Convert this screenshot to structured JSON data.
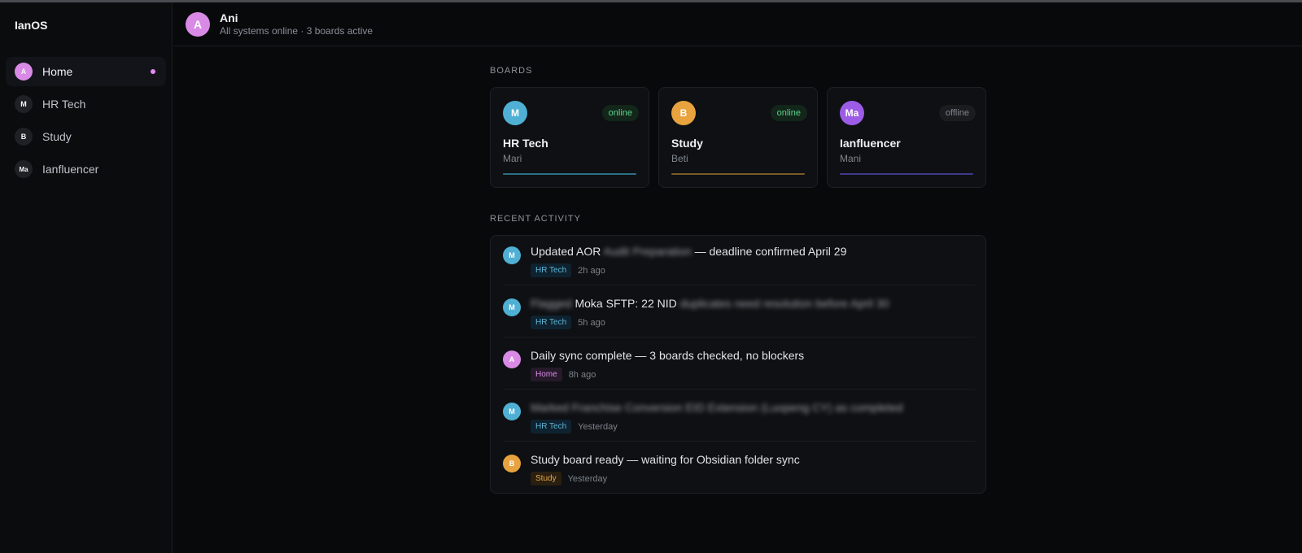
{
  "app": {
    "brand": "IanOS"
  },
  "sidebar": {
    "items": [
      {
        "avatar": "A",
        "label": "Home",
        "color": "#d98ae6",
        "active": true
      },
      {
        "avatar": "M",
        "label": "HR Tech",
        "color": "#1e2126"
      },
      {
        "avatar": "B",
        "label": "Study",
        "color": "#1e2126"
      },
      {
        "avatar": "Ma",
        "label": "Ianfluencer",
        "color": "#1e2126"
      }
    ]
  },
  "header": {
    "avatar": "A",
    "name": "Ani",
    "status": "All systems online · 3 boards active"
  },
  "boards_section": {
    "label": "BOARDS",
    "boards": [
      {
        "avatar": "M",
        "name": "HR Tech",
        "owner": "Mari",
        "status": "online",
        "avatar_color": "#4fb0d4",
        "bar_color": "#2b6f84"
      },
      {
        "avatar": "B",
        "name": "Study",
        "owner": "Beti",
        "status": "online",
        "avatar_color": "#e8a33e",
        "bar_color": "#7a5a2a"
      },
      {
        "avatar": "Ma",
        "name": "Ianfluencer",
        "owner": "Mani",
        "status": "offline",
        "avatar_color": "#9c5ce6",
        "bar_color": "#3f3a8a"
      }
    ]
  },
  "activity_section": {
    "label": "RECENT ACTIVITY",
    "items": [
      {
        "avatar": "M",
        "avatar_color": "#4fb0d4",
        "text_before": "Updated AOR",
        "text_blurred": "Audit Preparation",
        "text_after": "— deadline confirmed April 29",
        "tag": "HR Tech",
        "tag_kind": "hr",
        "time": "2h ago"
      },
      {
        "avatar": "M",
        "avatar_color": "#4fb0d4",
        "text_blurred_pre": "Flagged",
        "text_before": "Moka SFTP: 22 NID",
        "text_blurred": "duplicates need resolution before April 30",
        "text_after": "",
        "tag": "HR Tech",
        "tag_kind": "hr",
        "time": "5h ago"
      },
      {
        "avatar": "A",
        "avatar_color": "#d98ae6",
        "text_before": "Daily sync complete — 3 boards checked, no blockers",
        "text_blurred": "",
        "text_after": "",
        "tag": "Home",
        "tag_kind": "home",
        "time": "8h ago"
      },
      {
        "avatar": "M",
        "avatar_color": "#4fb0d4",
        "text_before": "",
        "text_blurred": "Marked Franchise Conversion EID Extension (Luopeng CY) as completed",
        "text_after": "",
        "tag": "HR Tech",
        "tag_kind": "hr",
        "time": "Yesterday"
      },
      {
        "avatar": "B",
        "avatar_color": "#e8a33e",
        "text_before": "Study board ready — waiting for Obsidian folder sync",
        "text_blurred": "",
        "text_after": "",
        "tag": "Study",
        "tag_kind": "study",
        "time": "Yesterday"
      }
    ]
  }
}
